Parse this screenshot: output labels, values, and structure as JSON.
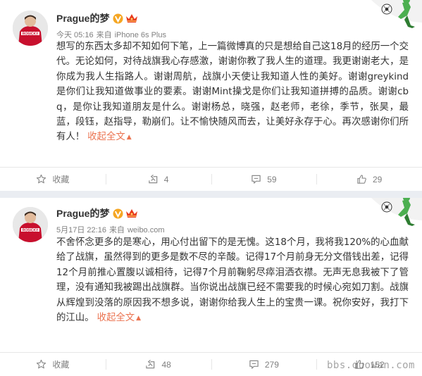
{
  "posts": [
    {
      "username": "Prague的梦",
      "time": "今天 05:16",
      "source_prefix": "来自",
      "source": "iPhone 6s Plus",
      "text": "想写的东西太多却不知如何下笔，上一篇微博真的只是想给自己这18月的经历一个交代。无论如何，对待战旗我心存感激，谢谢你教了我人生的道理。我更谢谢老大，是你成为我人生指路人。谢谢周航，战旗小天使让我知道人性的美好。谢谢greykind是你们让我知道做事业的要素。谢谢Mint操戈是你们让我知道拼搏的品质。谢谢cbq，是你让我知道朋友是什么。谢谢杨总，晓强，赵老师，老徐，季节，张昊，最蓝，段钰，赵指导，勒崩们。让不愉快随风而去，让美好永存于心。再次感谢你们所有人！",
      "collapse_label": "收起全文",
      "collapse_arrow": "▲",
      "actions": {
        "favorite": "收藏",
        "repost": "4",
        "comment": "59",
        "like": "29"
      }
    },
    {
      "username": "Prague的梦",
      "time": "5月17日 22:16",
      "source_prefix": "来自",
      "source": "weibo.com",
      "text": "不舍怀念更多的是寒心，用心付出留下的是无愧。这18个月，我将我120%的心血献给了战旗，虽然得到的更多是数不尽的辛酸。记得17个月前身无分文借钱出差，记得12个月前推心置腹以诚相待，记得7个月前鞠躬尽瘁泪洒衣襟。无声无息我被下了管理，没有通知我被踢出战旗群。当你说出战旗已经不需要我的时候心宛如刀割。战旗从辉煌到没落的原因我不想多说，谢谢你给我人生上的宝贵一课。祝你安好，我打下的江山。",
      "collapse_label": "收起全文",
      "collapse_arrow": "▲",
      "actions": {
        "favorite": "收藏",
        "repost": "48",
        "comment": "279",
        "like": "152"
      }
    }
  ],
  "watermark": "bbs.duowan.com",
  "colors": {
    "background": "#eaedf2",
    "card": "#ffffff",
    "text": "#333333",
    "meta": "#808080",
    "link": "#eb7350",
    "verified_badge": "#f5a623"
  },
  "icons": [
    "verified-badge-icon",
    "vip-crown-icon",
    "star-icon",
    "repost-icon",
    "comment-icon",
    "thumbs-up-icon",
    "football-decoration-icon"
  ]
}
